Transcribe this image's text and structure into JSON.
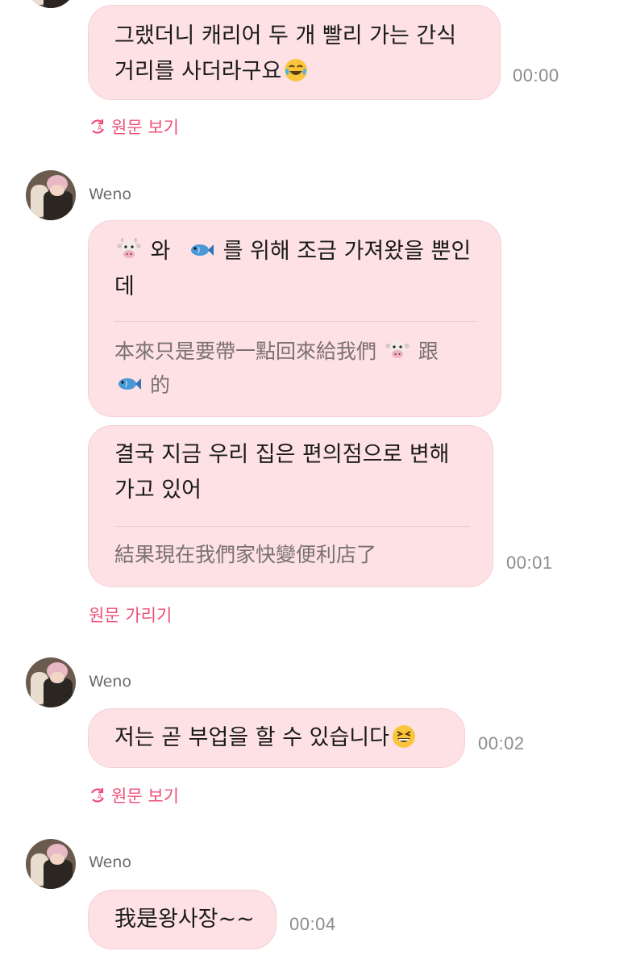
{
  "messages": [
    {
      "lines": [
        "그랬더니 캐리어 두 개 빨리 가는 간식",
        "거리를 사더라구요"
      ],
      "time": "00:00",
      "action": "원문 보기"
    },
    {
      "sender": "Weno",
      "lines": [
        "와",
        "를 위해 조금 가져왔을 뿐인",
        "데"
      ],
      "translation": [
        "本來只是要帶一點回來給我們",
        "跟",
        "的"
      ]
    },
    {
      "lines": [
        "결국 지금 우리 집은 편의점으로 변해",
        "가고 있어"
      ],
      "translation": [
        "結果現在我們家快變便利店了"
      ],
      "time": "00:01",
      "action": "원문 가리기"
    },
    {
      "sender": "Weno",
      "lines": [
        "저는 곧 부업을 할 수 있습니다"
      ],
      "time": "00:02",
      "action": "원문 보기"
    },
    {
      "sender": "Weno",
      "lines": [
        "我是왕사장~~"
      ],
      "time": "00:04"
    }
  ],
  "icons": [
    "laughing-tears-emoji",
    "cow-face-emoji",
    "fish-emoji",
    "grinning-squinting-emoji",
    "translate-icon"
  ],
  "colors": {
    "bubble": "#fde1e5",
    "accent": "#ee4f79",
    "time": "#8c8c8c"
  }
}
